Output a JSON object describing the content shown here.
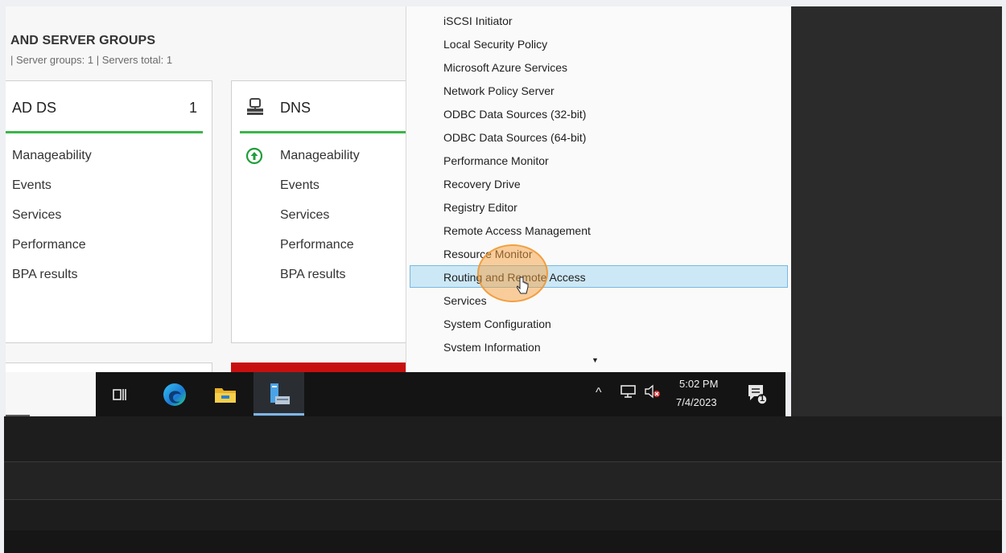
{
  "dashboard": {
    "heading": "AND SERVER GROUPS",
    "subheading": "|   Server groups: 1   |   Servers total: 1",
    "tiles": [
      {
        "title": "AD DS",
        "count": "1",
        "status_color": "#3bb54a",
        "rows": [
          "Manageability",
          "Events",
          "Services",
          "Performance",
          "BPA results"
        ]
      },
      {
        "title": "DNS",
        "status_color": "#3bb54a",
        "icon": "dns-server-icon",
        "status_icon": "up-arrow-circle-icon",
        "rows": [
          "Manageability",
          "Events",
          "Services",
          "Performance",
          "BPA results"
        ]
      }
    ]
  },
  "tools_menu": {
    "items": [
      "iSCSI Initiator",
      "Local Security Policy",
      "Microsoft Azure Services",
      "Network Policy Server",
      "ODBC Data Sources (32-bit)",
      "ODBC Data Sources (64-bit)",
      "Performance Monitor",
      "Recovery Drive",
      "Registry Editor",
      "Remote Access Management",
      "Resource Monitor",
      "Routing and Remote Access",
      "Services",
      "System Configuration",
      "Svstem Information"
    ],
    "highlighted": "Routing and Remote Access",
    "scroll_indicator": "scroll-down-arrow-icon"
  },
  "taskbar": {
    "icons": [
      "task-view-icon",
      "edge-icon",
      "file-explorer-icon",
      "server-manager-icon"
    ],
    "active": "server-manager-icon",
    "tray": {
      "time": "5:02 PM",
      "date": "7/4/2023",
      "notification_count": "1"
    }
  },
  "colors": {
    "highlight": "#cce8f6",
    "alert_tile": "#c80f0f",
    "taskbar": "#141414"
  }
}
